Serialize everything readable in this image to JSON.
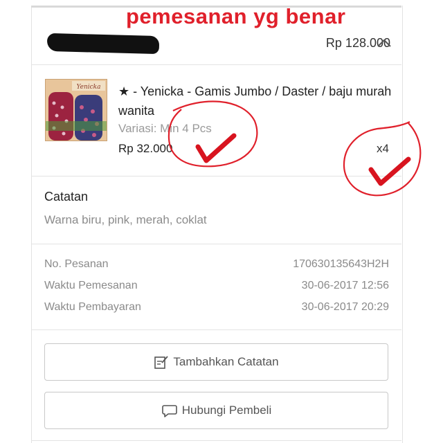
{
  "annotation": {
    "title": "pemesanan yg benar",
    "color": "#e0202b"
  },
  "order": {
    "total": "Rp 128.000",
    "toggle_icon": "chevron-up-icon"
  },
  "product": {
    "name": "★ - Yenicka - Gamis Jumbo / Daster / baju murah wanita",
    "variant": "Variasi: Min 4 Pcs",
    "price": "Rp 32.000",
    "quantity": "x4",
    "thumbnail_text": "Yenicka"
  },
  "notes": {
    "heading": "Catatan",
    "text": "Warna biru, pink, merah, coklat"
  },
  "info": [
    {
      "label": "No. Pesanan",
      "value": "170630135643H2H"
    },
    {
      "label": "Waktu Pemesanan",
      "value": "30-06-2017 12:56"
    },
    {
      "label": "Waktu Pembayaran",
      "value": "30-06-2017 20:29"
    }
  ],
  "actions": {
    "add_note": {
      "label": "Tambahkan Catatan",
      "icon": "edit-note-icon"
    },
    "contact_buyer": {
      "label": "Hubungi Pembeli",
      "icon": "chat-bubble-icon"
    }
  }
}
